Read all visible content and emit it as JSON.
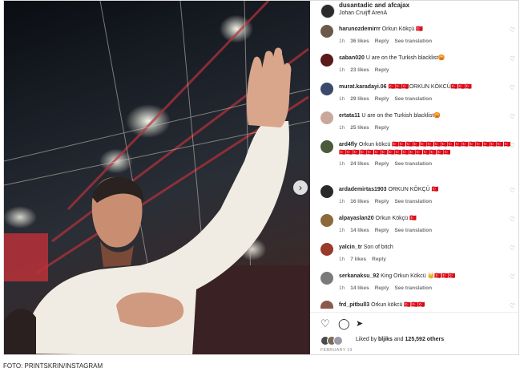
{
  "post": {
    "header": {
      "username": "dusantadic and afcajax",
      "location": "Johan Cruijff ArenA"
    },
    "comments": [
      {
        "user": "harunozdemirrr",
        "text": "Orkun Kökçü 🇹🇷",
        "time": "1h",
        "likes": "36 likes",
        "reply": "Reply",
        "translate": "See translation",
        "avatar_color": "#6b5a4a"
      },
      {
        "user": "saban020",
        "text": "U are on the Turkish blacklist😡",
        "time": "1h",
        "likes": "23 likes",
        "reply": "Reply",
        "translate": "",
        "avatar_color": "#5a1a1a"
      },
      {
        "user": "murat.karadayi.06",
        "text": "🇹🇷🇹🇷🇹🇷ORKUN KÖKCÜ🇹🇷🇹🇷🇹🇷",
        "time": "1h",
        "likes": "29 likes",
        "reply": "Reply",
        "translate": "See translation",
        "avatar_color": "#3a4a6a"
      },
      {
        "user": "ertata11",
        "text": "U are on the Turkish blacklist😡",
        "time": "1h",
        "likes": "25 likes",
        "reply": "Reply",
        "translate": "",
        "avatar_color": "#c9a89a"
      },
      {
        "user": "ard4fly",
        "text": "Orkun kökcü 🇹🇷🇹🇷🇹🇷🇹🇷🇹🇷🇹🇷🇹🇷🇹🇷🇹🇷🇹🇷🇹🇷🇹🇷🇹🇷🇹🇷🇹🇷🇹🇷🇹🇷🇹🇷🇹🇷🇹🇷🇹🇷🇹🇷🇹🇷🇹🇷🇹🇷🇹🇷🇹🇷🇹🇷🇹🇷🇹🇷🇹🇷🇹🇷🇹🇷",
        "time": "1h",
        "likes": "24 likes",
        "reply": "Reply",
        "translate": "See translation",
        "avatar_color": "#4a5a3a"
      },
      {
        "user": "ardademirtas1903",
        "text": "ORKUN KÖKÇÜ 🇹🇷",
        "time": "1h",
        "likes": "16 likes",
        "reply": "Reply",
        "translate": "See translation",
        "avatar_color": "#2a2a2a"
      },
      {
        "user": "alpayaslan20",
        "text": "Orkun Kökçü 🇹🇷",
        "time": "1h",
        "likes": "14 likes",
        "reply": "Reply",
        "translate": "See translation",
        "avatar_color": "#8a6a3a"
      },
      {
        "user": "yalcin_tr",
        "text": "Son of bitch",
        "time": "1h",
        "likes": "7 likes",
        "reply": "Reply",
        "translate": "",
        "avatar_color": "#9a3a2a"
      },
      {
        "user": "serkanaksu_92",
        "text": "King Orkun Kökcü 👑🇹🇷🇹🇷🇹🇷",
        "time": "1h",
        "likes": "14 likes",
        "reply": "Reply",
        "translate": "See translation",
        "avatar_color": "#7a7a7a"
      },
      {
        "user": "frd_pitbull3",
        "text": "Orkun kökcü 🇹🇷🇹🇷🇹🇷",
        "time": "",
        "likes": "",
        "reply": "",
        "translate": "",
        "avatar_color": "#8a5a4a"
      }
    ],
    "actions": {
      "like_icon": "heart-icon",
      "comment_icon": "comment-icon",
      "share_icon": "share-icon"
    },
    "liked_by": {
      "prefix": "Liked by",
      "user": "bljiks",
      "middle": "and",
      "count": "125,592 others"
    },
    "date": "FEBRUARY 19"
  },
  "caption": "FOTO: PRINTSKRIN/INSTAGRAM",
  "colors": {
    "border": "#dbdbdb",
    "text": "#262626",
    "muted": "#737373"
  }
}
